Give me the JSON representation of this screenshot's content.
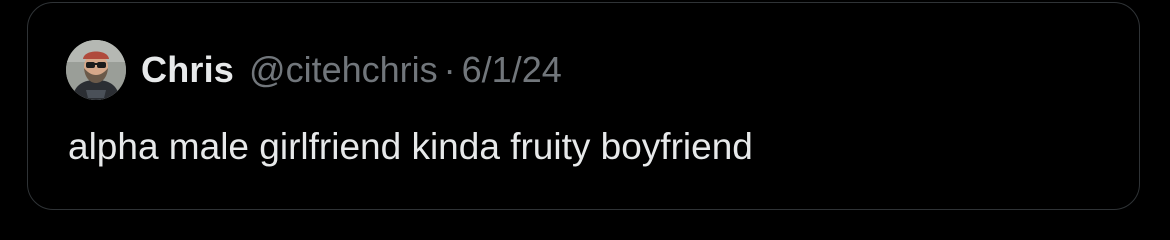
{
  "quoted_tweet": {
    "author": {
      "display_name": "Chris",
      "handle": "@citehchris",
      "avatar_icon": "profile-photo"
    },
    "separator": "·",
    "date": "6/1/24",
    "text": "alpha male girlfriend kinda fruity boyfriend"
  },
  "colors": {
    "background": "#000000",
    "border": "#2f3336",
    "primary_text": "#e7e9ea",
    "secondary_text": "#71767b"
  }
}
